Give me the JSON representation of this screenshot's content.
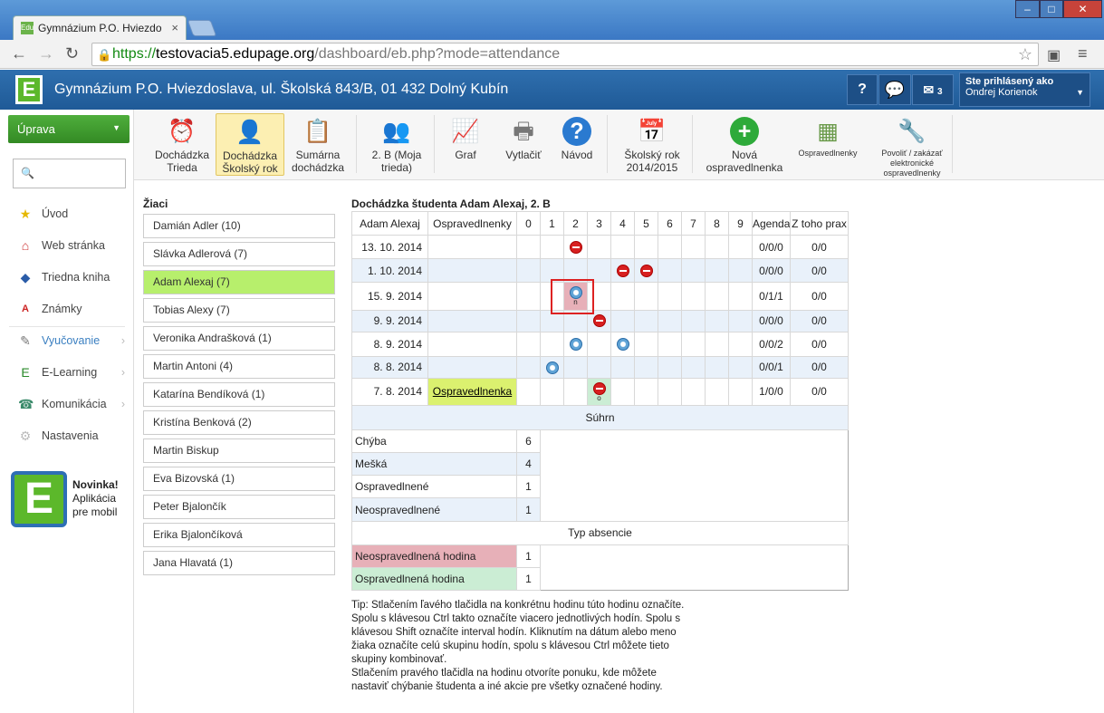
{
  "browser": {
    "tab_title": "Gymnázium P.O. Hviezdo",
    "tab_favicon": "Edu",
    "url_scheme": "https://",
    "url_host": "testovacia5.edupage.org",
    "url_path": "/dashboard/eb.php?mode=attendance"
  },
  "header": {
    "logo": "E",
    "title": "Gymnázium P.O. Hviezdoslava, ul. Školská 843/B, 01 432 Dolný Kubín",
    "help_label": "?",
    "messages_count": "3",
    "user_line1": "Ste prihlásený ako",
    "user_line2": "Ondrej Korienok"
  },
  "sidebar": {
    "edit_label": "Úprava",
    "items": [
      {
        "label": "Úvod",
        "icon": "star-icon"
      },
      {
        "label": "Web stránka",
        "icon": "house-icon"
      },
      {
        "label": "Triedna kniha",
        "icon": "book-icon"
      },
      {
        "label": "Známky",
        "icon": "grade-icon"
      },
      {
        "label": "Vyučovanie",
        "icon": "teaching-icon"
      },
      {
        "label": "E-Learning",
        "icon": "elearning-icon"
      },
      {
        "label": "Komunikácia",
        "icon": "communication-icon"
      },
      {
        "label": "Nastavenia",
        "icon": "settings-icon"
      }
    ],
    "promo_title": "Novinka!",
    "promo_line1": "Aplikácia",
    "promo_line2": "pre mobil"
  },
  "toolbar": {
    "items": [
      {
        "l1": "Dochádzka",
        "l2": "Trieda",
        "icon": "alarm-clock-icon"
      },
      {
        "l1": "Dochádzka",
        "l2": "Školský rok",
        "icon": "person-check-icon"
      },
      {
        "l1": "Sumárna",
        "l2": "dochádzka",
        "icon": "summary-icon"
      },
      {
        "l1": "2. B (Moja",
        "l2": "trieda)",
        "icon": "class-group-icon"
      },
      {
        "l1": "Graf",
        "l2": "",
        "icon": "chart-icon"
      },
      {
        "l1": "Vytlačiť",
        "l2": "",
        "icon": "printer-icon"
      },
      {
        "l1": "Návod",
        "l2": "",
        "icon": "help-icon"
      },
      {
        "l1": "Školský rok",
        "l2": "2014/2015",
        "icon": "calendar-icon"
      },
      {
        "l1": "Nová",
        "l2": "ospravedlnenka",
        "icon": "add-icon"
      },
      {
        "l1": "Ospravedlnenky",
        "l2": "",
        "icon": "excuses-icon"
      },
      {
        "l1": "Povoliť / zakázať",
        "l2": "elektronické",
        "l3": "ospravedlnenky",
        "icon": "tools-icon"
      }
    ]
  },
  "students": {
    "title": "Žiaci",
    "list": [
      "Damián Adler (10)",
      "Slávka Adlerová (7)",
      "Adam Alexaj (7)",
      "Tobias Alexy (7)",
      "Veronika Andrašková (1)",
      "Martin Antoni (4)",
      "Katarína Bendíková (1)",
      "Kristína Benková (2)",
      "Martin Biskup",
      "Eva Bizovská (1)",
      "Peter Bjalončík",
      "Erika Bjalončíková",
      "Jana Hlavatá (1)"
    ]
  },
  "attendance": {
    "title": "Dochádzka študenta Adam Alexaj, 2. B",
    "headers": [
      "Adam Alexaj",
      "Ospravedlnenky",
      "0",
      "1",
      "2",
      "3",
      "4",
      "5",
      "6",
      "7",
      "8",
      "9",
      "Agenda",
      "Z toho prax"
    ],
    "rows": [
      {
        "date": "13. 10. 2014",
        "excuse": "",
        "agenda": "0/0/0",
        "prax": "0/0"
      },
      {
        "date": "1. 10. 2014",
        "excuse": "",
        "agenda": "0/0/0",
        "prax": "0/0"
      },
      {
        "date": "15. 9. 2014",
        "excuse": "",
        "agenda": "0/1/1",
        "prax": "0/0",
        "mark2": "n"
      },
      {
        "date": "9. 9. 2014",
        "excuse": "",
        "agenda": "0/0/0",
        "prax": "0/0"
      },
      {
        "date": "8. 9. 2014",
        "excuse": "",
        "agenda": "0/0/2",
        "prax": "0/0"
      },
      {
        "date": "8. 8. 2014",
        "excuse": "",
        "agenda": "0/0/1",
        "prax": "0/0"
      },
      {
        "date": "7. 8. 2014",
        "excuse": "Ospravedlnenka",
        "agenda": "1/0/0",
        "prax": "0/0",
        "mark3": "o"
      }
    ],
    "summary_title": "Súhrn",
    "summary": [
      {
        "label": "Chýba",
        "value": "6"
      },
      {
        "label": "Mešká",
        "value": "4"
      },
      {
        "label": "Ospravedlnené",
        "value": "1"
      },
      {
        "label": "Neospravedlnené",
        "value": "1"
      }
    ],
    "types_title": "Typ absencie",
    "types": [
      {
        "label": "Neospravedlnená hodina",
        "value": "1",
        "color": "#e7b0b8"
      },
      {
        "label": "Ospravedlnená hodina",
        "value": "1",
        "color": "#cbedd4"
      }
    ]
  },
  "tip": {
    "line1": "Tip: Stlačením ľavého tlačidla na konkrétnu hodinu túto hodinu označíte.",
    "line2": "Spolu s klávesou Ctrl takto označíte viacero jednotlivých hodín. Spolu s",
    "line3": "klávesou Shift označíte interval hodín. Kliknutím na dátum alebo meno",
    "line4": "žiaka označíte celú skupinu hodín, spolu s klávesou Ctrl môžete tieto",
    "line5": "skupiny kombinovať.",
    "line6": "Stlačením pravého tlačidla na hodinu otvoríte ponuku, kde môžete",
    "line7": "nastaviť chýbanie študenta a iné akcie pre všetky označené hodiny."
  }
}
